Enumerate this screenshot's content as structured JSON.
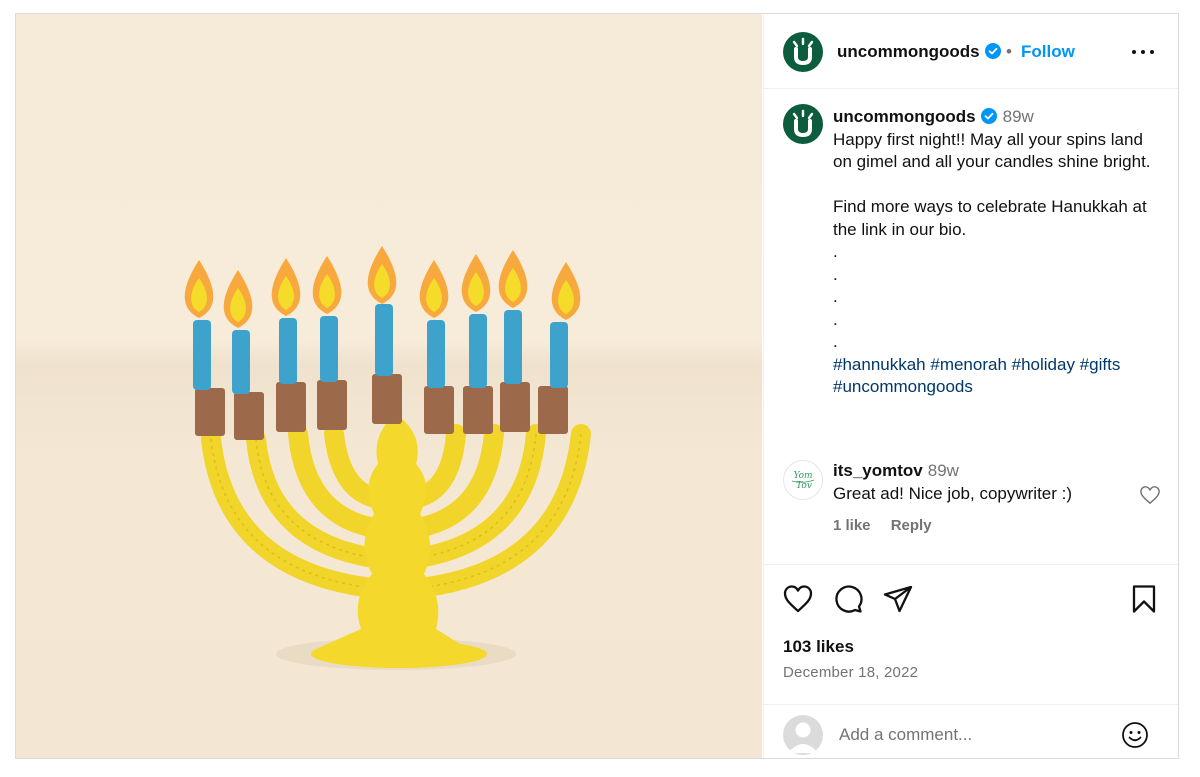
{
  "post": {
    "media_alt": "Felt menorah with nine candles",
    "author": {
      "username": "uncommongoods",
      "verified": true,
      "avatar_letter": "U",
      "brand_color": "#0d5c3e"
    },
    "header": {
      "separator": "•",
      "follow_label": "Follow"
    },
    "caption": {
      "time": "89w",
      "lines": [
        "Happy first night!! May all your spins land on gimel and all your candles shine bright.",
        "",
        "Find more ways to celebrate Hanukkah at the link in our bio.",
        ".",
        ".",
        ".",
        ".",
        "."
      ],
      "hashtags": "#hannukkah #menorah #holiday #gifts #uncommongoods"
    },
    "comments": [
      {
        "username": "its_yomtov",
        "avatar_text": "Yom Tov",
        "time": "89w",
        "text": "Great ad! Nice job, copywriter :)",
        "likes_label": "1 like",
        "reply_label": "Reply"
      }
    ],
    "likes": "103 likes",
    "date": "December 18, 2022",
    "add_comment": {
      "placeholder": "Add a comment..."
    }
  },
  "colors": {
    "link": "#0095f6",
    "hashtag": "#00376b",
    "muted": "#737373",
    "verified": "#0095f6"
  }
}
